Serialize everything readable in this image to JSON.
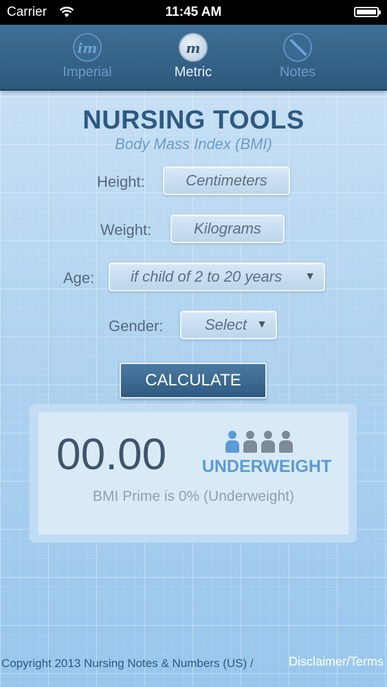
{
  "status_bar": {
    "carrier": "Carrier",
    "time": "11:45 AM"
  },
  "tabs": [
    {
      "label": "Imperial",
      "glyph": "im",
      "icon": "imperial-icon",
      "active": false
    },
    {
      "label": "Metric",
      "glyph": "m",
      "icon": "metric-icon",
      "active": true
    },
    {
      "label": "Notes",
      "icon": "pencil-icon",
      "active": false
    }
  ],
  "header": {
    "title": "NURSING TOOLS",
    "subtitle": "Body Mass Index (BMI)"
  },
  "form": {
    "height_label": "Height:",
    "height_placeholder": "Centimeters",
    "weight_label": "Weight:",
    "weight_placeholder": "Kilograms",
    "age_label": "Age:",
    "age_value": "if child of 2 to 20 years",
    "gender_label": "Gender:",
    "gender_value": "Select",
    "dropdown_arrow": "▼",
    "calculate_label": "CALCULATE"
  },
  "result": {
    "bmi_value": "00.00",
    "category": "UNDERWEIGHT",
    "bmi_prime": "BMI Prime is 0%  (Underweight)",
    "category_level": 1,
    "category_levels_total": 4,
    "active_color": "#5b9bd5",
    "inactive_color": "#7e8b96"
  },
  "footer": {
    "copyright": "Copyright 2013 Nursing Notes & Numbers (US) /",
    "disclaimer": "Disclaimer/Terms"
  }
}
